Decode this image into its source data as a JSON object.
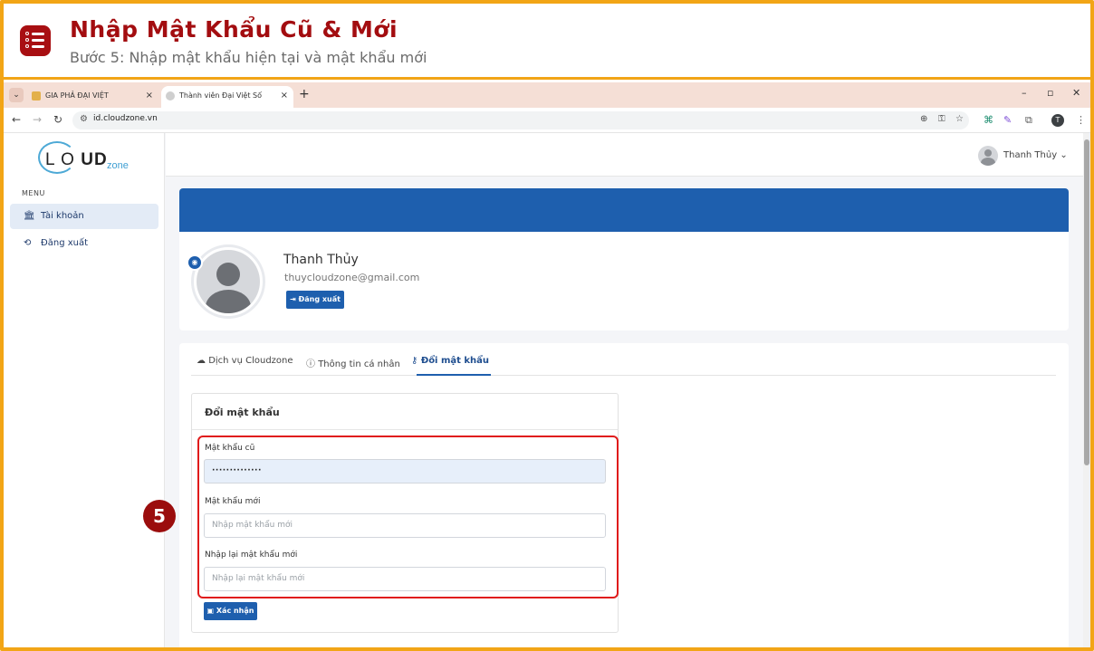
{
  "banner": {
    "title": "Nhập Mật Khẩu Cũ & Mới",
    "subtitle": "Bước 5: Nhập mật khẩu hiện tại và mật khẩu mới",
    "icon": "list-icon",
    "accent": "#a30d10",
    "border": "#f2a516"
  },
  "browser": {
    "tabs": [
      {
        "label": "GIA PHẢ ĐẠI VIỆT",
        "close": "×"
      },
      {
        "label": "Thành viên Đại Việt Số",
        "close": "×"
      }
    ],
    "new_tab": "+",
    "url": "id.cloudzone.vn",
    "profile_initial": "T",
    "window_controls": [
      "–",
      "▫",
      "✕"
    ]
  },
  "sidebar": {
    "logo": {
      "letters_left": "L",
      "letters_bold": "UD",
      "zone": "zone"
    },
    "menu_heading": "MENU",
    "items": [
      {
        "label": "Tài khoản",
        "icon": "bank-icon",
        "active": true
      },
      {
        "label": "Đăng xuất",
        "icon": "logout-icon",
        "active": false
      }
    ]
  },
  "topbar": {
    "user_name": "Thanh Thủy",
    "chevron": "⌄"
  },
  "profile": {
    "name": "Thanh Thủy",
    "email": "thuycloudzone@gmail.com",
    "logout_button": "Đăng xuất",
    "cover_color": "#1e5fae"
  },
  "tabs": [
    {
      "label": "Dịch vụ Cloudzone",
      "icon": "cloud-icon",
      "active": false
    },
    {
      "label": "Thông tin cá nhân",
      "icon": "info-icon",
      "active": false
    },
    {
      "label": "Đổi mật khẩu",
      "icon": "key-icon",
      "active": true
    }
  ],
  "form": {
    "title": "Đổi mật khẩu",
    "old_label": "Mật khẩu cũ",
    "old_value": "··············",
    "new_label": "Mật khẩu mới",
    "new_placeholder": "Nhập mật khẩu mới",
    "confirm_label": "Nhập lại mật khẩu mới",
    "confirm_placeholder": "Nhập lại mật khẩu mới",
    "submit": "Xác nhận"
  },
  "annotation": {
    "step": "5",
    "highlight_color": "#e01b1b"
  }
}
